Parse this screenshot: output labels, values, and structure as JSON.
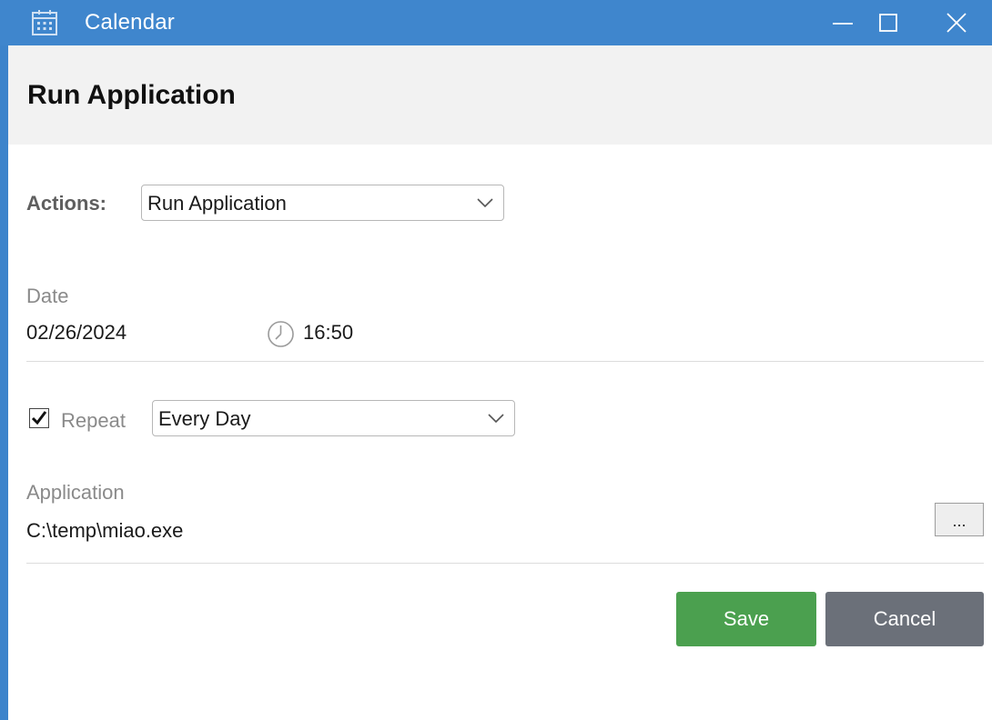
{
  "window": {
    "title": "Calendar",
    "icon": "calendar-icon",
    "controls": [
      "minimize-icon",
      "maximize-icon",
      "close-icon"
    ]
  },
  "dialog": {
    "heading": "Run Application"
  },
  "form": {
    "actions": {
      "label": "Actions:",
      "selected": "Run Application"
    },
    "date": {
      "label": "Date",
      "value": "02/26/2024",
      "time_icon": "clock-icon",
      "time_value": "16:50"
    },
    "repeat": {
      "checked": true,
      "label": "Repeat",
      "selected": "Every Day"
    },
    "application": {
      "label": "Application",
      "path": "C:\\temp\\miao.exe",
      "browse_label": "..."
    }
  },
  "buttons": {
    "save_label": "Save",
    "cancel_label": "Cancel"
  },
  "colors": {
    "titlebar": "#3f86cd",
    "save": "#4ba04f",
    "cancel": "#6b7079"
  }
}
